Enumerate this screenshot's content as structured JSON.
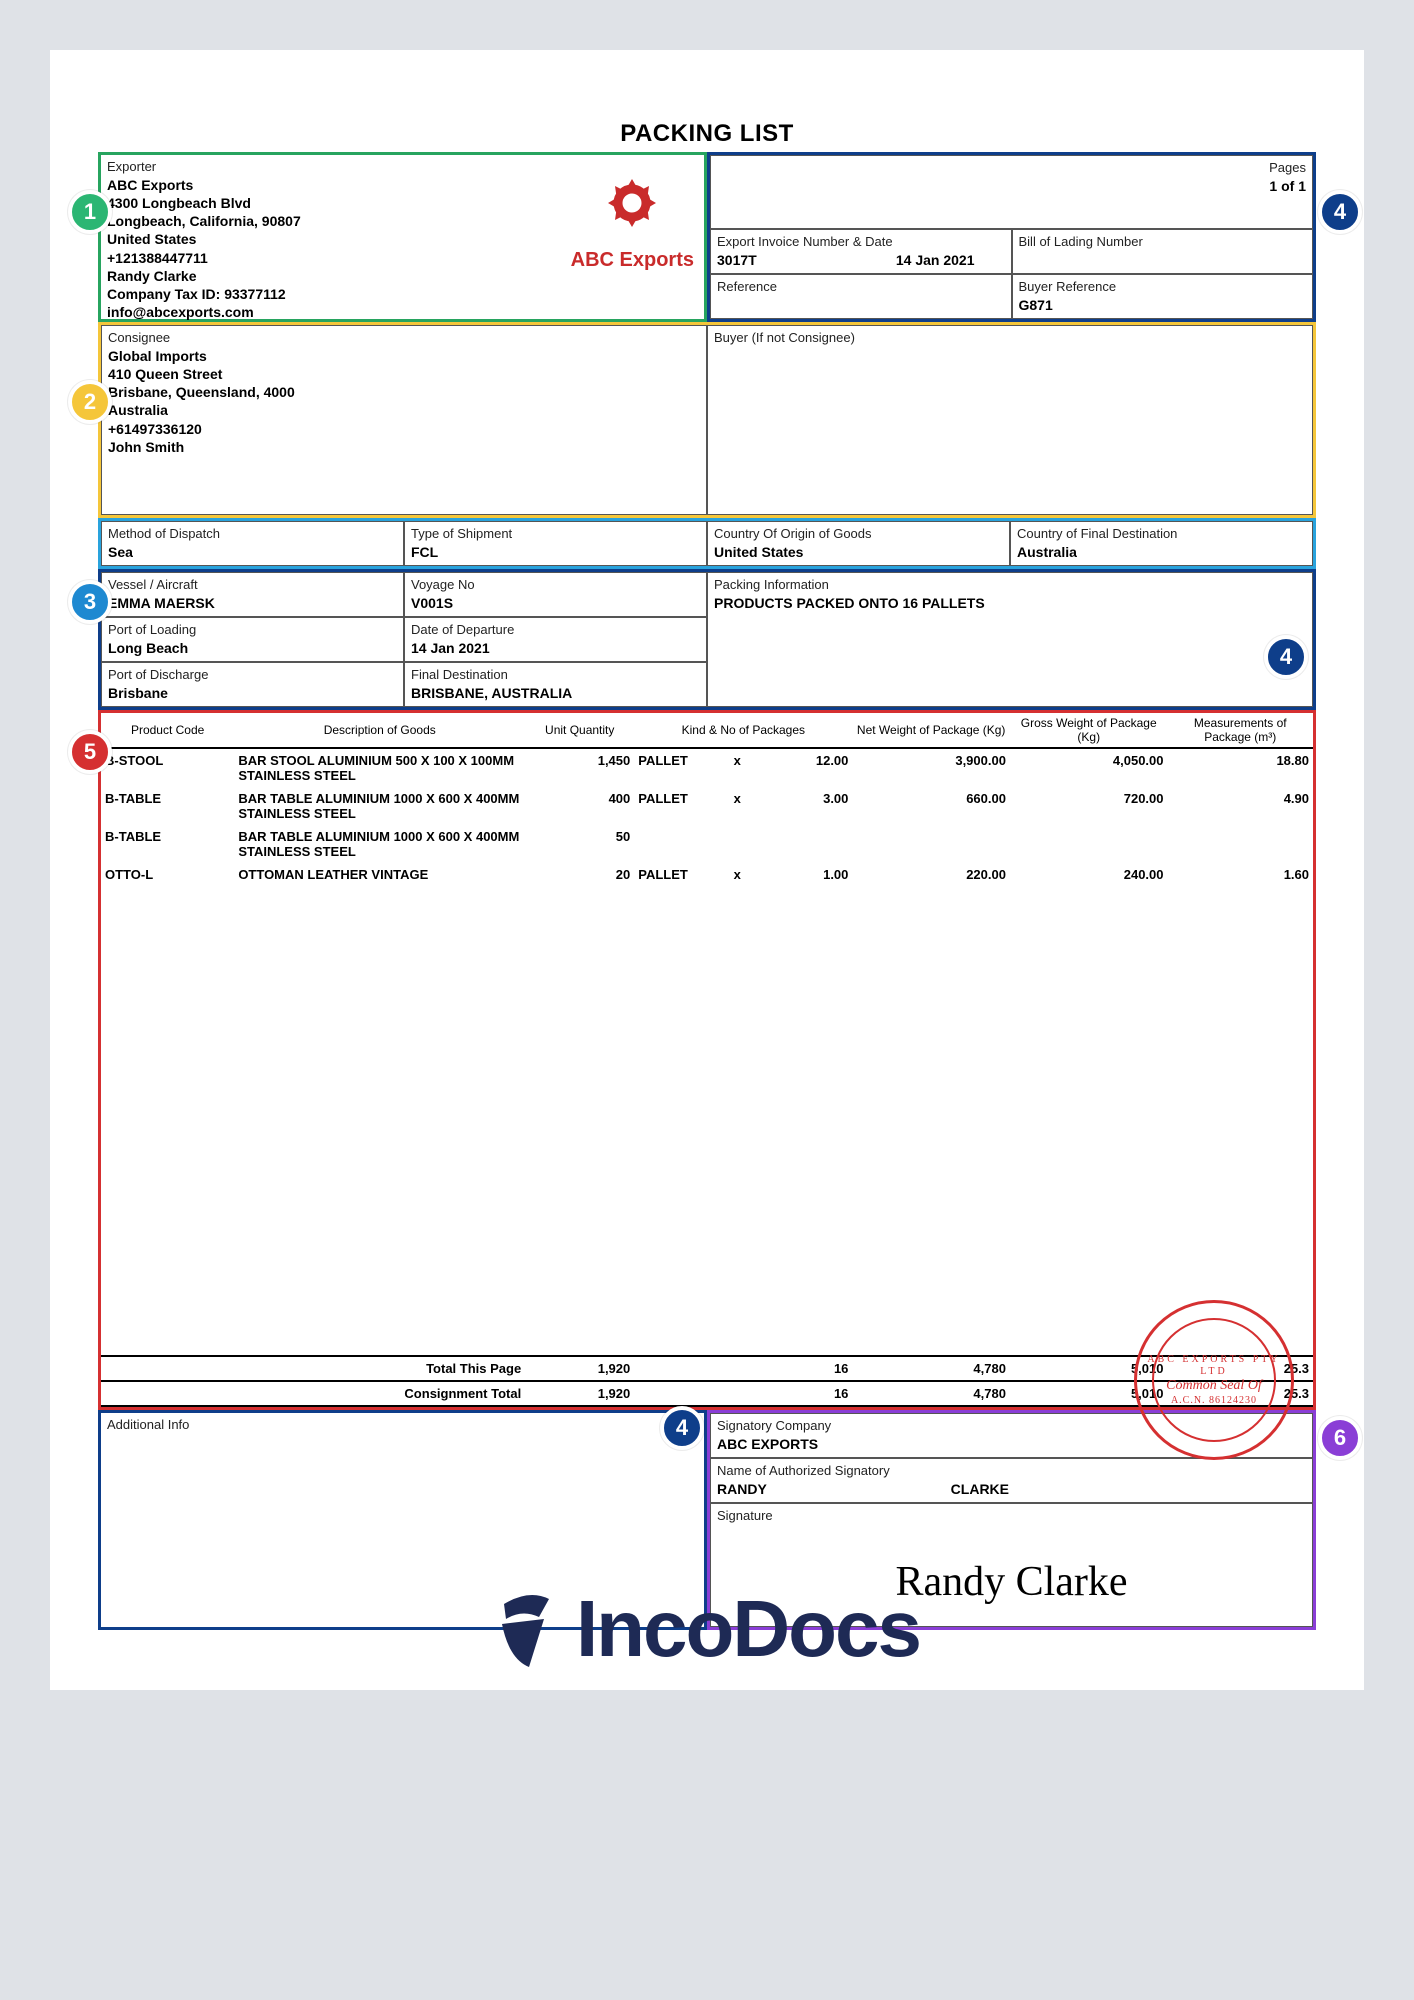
{
  "title": "PACKING LIST",
  "pages": {
    "label": "Pages",
    "value": "1 of 1"
  },
  "exporter": {
    "label": "Exporter",
    "name": "ABC Exports",
    "addr1": "4300 Longbeach Blvd",
    "addr2": "Longbeach, California, 90807",
    "country": "United States",
    "phone": "+121388447711",
    "contact": "Randy Clarke",
    "tax": "Company Tax ID: 93377112",
    "email": "info@abcexports.com",
    "logo_text": "ABC Exports"
  },
  "invoice": {
    "label": "Export Invoice Number & Date",
    "num": "3017T",
    "date": "14 Jan 2021"
  },
  "bol": {
    "label": "Bill of Lading Number",
    "value": ""
  },
  "reference": {
    "label": "Reference",
    "value": ""
  },
  "buyer_ref": {
    "label": "Buyer Reference",
    "value": "G871"
  },
  "consignee": {
    "label": "Consignee",
    "name": "Global Imports",
    "addr1": "410 Queen Street",
    "addr2": "Brisbane, Queensland, 4000",
    "country": "Australia",
    "phone": "+61497336120",
    "contact": "John Smith"
  },
  "buyer": {
    "label": "Buyer (If not Consignee)",
    "value": ""
  },
  "dispatch": {
    "method": {
      "label": "Method of Dispatch",
      "value": "Sea"
    },
    "shipment": {
      "label": "Type of Shipment",
      "value": "FCL"
    }
  },
  "origin": {
    "label": "Country Of Origin of Goods",
    "value": "United States"
  },
  "dest_country": {
    "label": "Country of Final Destination",
    "value": "Australia"
  },
  "vessel": {
    "label": "Vessel / Aircraft",
    "value": "EMMA MAERSK"
  },
  "voyage": {
    "label": "Voyage No",
    "value": "V001S"
  },
  "packing_info": {
    "label": "Packing Information",
    "value": "PRODUCTS PACKED ONTO 16 PALLETS"
  },
  "port_loading": {
    "label": "Port of Loading",
    "value": "Long Beach"
  },
  "departure": {
    "label": "Date of Departure",
    "value": "14 Jan 2021"
  },
  "port_discharge": {
    "label": "Port of Discharge",
    "value": "Brisbane"
  },
  "final_dest": {
    "label": "Final Destination",
    "value": "BRISBANE, AUSTRALIA"
  },
  "headers": {
    "code": "Product Code",
    "desc": "Description of Goods",
    "qty": "Unit Quantity",
    "kind": "Kind & No of Packages",
    "net": "Net Weight of Package (Kg)",
    "gross": "Gross Weight of Package (Kg)",
    "meas": "Measurements of Package (m³)"
  },
  "items": [
    {
      "code": "B-STOOL",
      "desc": "BAR STOOL ALUMINIUM 500 X 100 X 100MM STAINLESS STEEL",
      "qty": "1,450",
      "kind": "PALLET",
      "x": "x",
      "pkgs": "12.00",
      "net": "3,900.00",
      "gross": "4,050.00",
      "meas": "18.80"
    },
    {
      "code": "B-TABLE",
      "desc": "BAR TABLE ALUMINIUM 1000 X 600 X 400MM STAINLESS STEEL",
      "qty": "400",
      "kind": "PALLET",
      "x": "x",
      "pkgs": "3.00",
      "net": "660.00",
      "gross": "720.00",
      "meas": "4.90"
    },
    {
      "code": "B-TABLE",
      "desc": "BAR TABLE ALUMINIUM 1000 X 600 X 400MM STAINLESS STEEL",
      "qty": "50",
      "kind": "",
      "x": "",
      "pkgs": "",
      "net": "",
      "gross": "",
      "meas": ""
    },
    {
      "code": "OTTO-L",
      "desc": "OTTOMAN LEATHER VINTAGE",
      "qty": "20",
      "kind": "PALLET",
      "x": "x",
      "pkgs": "1.00",
      "net": "220.00",
      "gross": "240.00",
      "meas": "1.60"
    }
  ],
  "totals": {
    "page": {
      "label": "Total This Page",
      "qty": "1,920",
      "pkgs": "16",
      "net": "4,780",
      "gross": "5,010",
      "meas": "25.3"
    },
    "cons": {
      "label": "Consignment Total",
      "qty": "1,920",
      "pkgs": "16",
      "net": "4,780",
      "gross": "5,010",
      "meas": "25.3"
    }
  },
  "additional": {
    "label": "Additional Info"
  },
  "signatory": {
    "company": {
      "label": "Signatory Company",
      "value": "ABC EXPORTS"
    },
    "name": {
      "label": "Name of Authorized Signatory",
      "first": "RANDY",
      "last": "CLARKE"
    },
    "sig_label": "Signature",
    "signature": "Randy Clarke"
  },
  "seal": {
    "top": "EXPORTS",
    "text": "Common Seal Of",
    "reg": "A.C.N. 86124230"
  },
  "watermark": "IncoDocs",
  "callouts": {
    "1": "1",
    "2": "2",
    "3": "3",
    "4": "4",
    "5": "5",
    "6": "6"
  }
}
